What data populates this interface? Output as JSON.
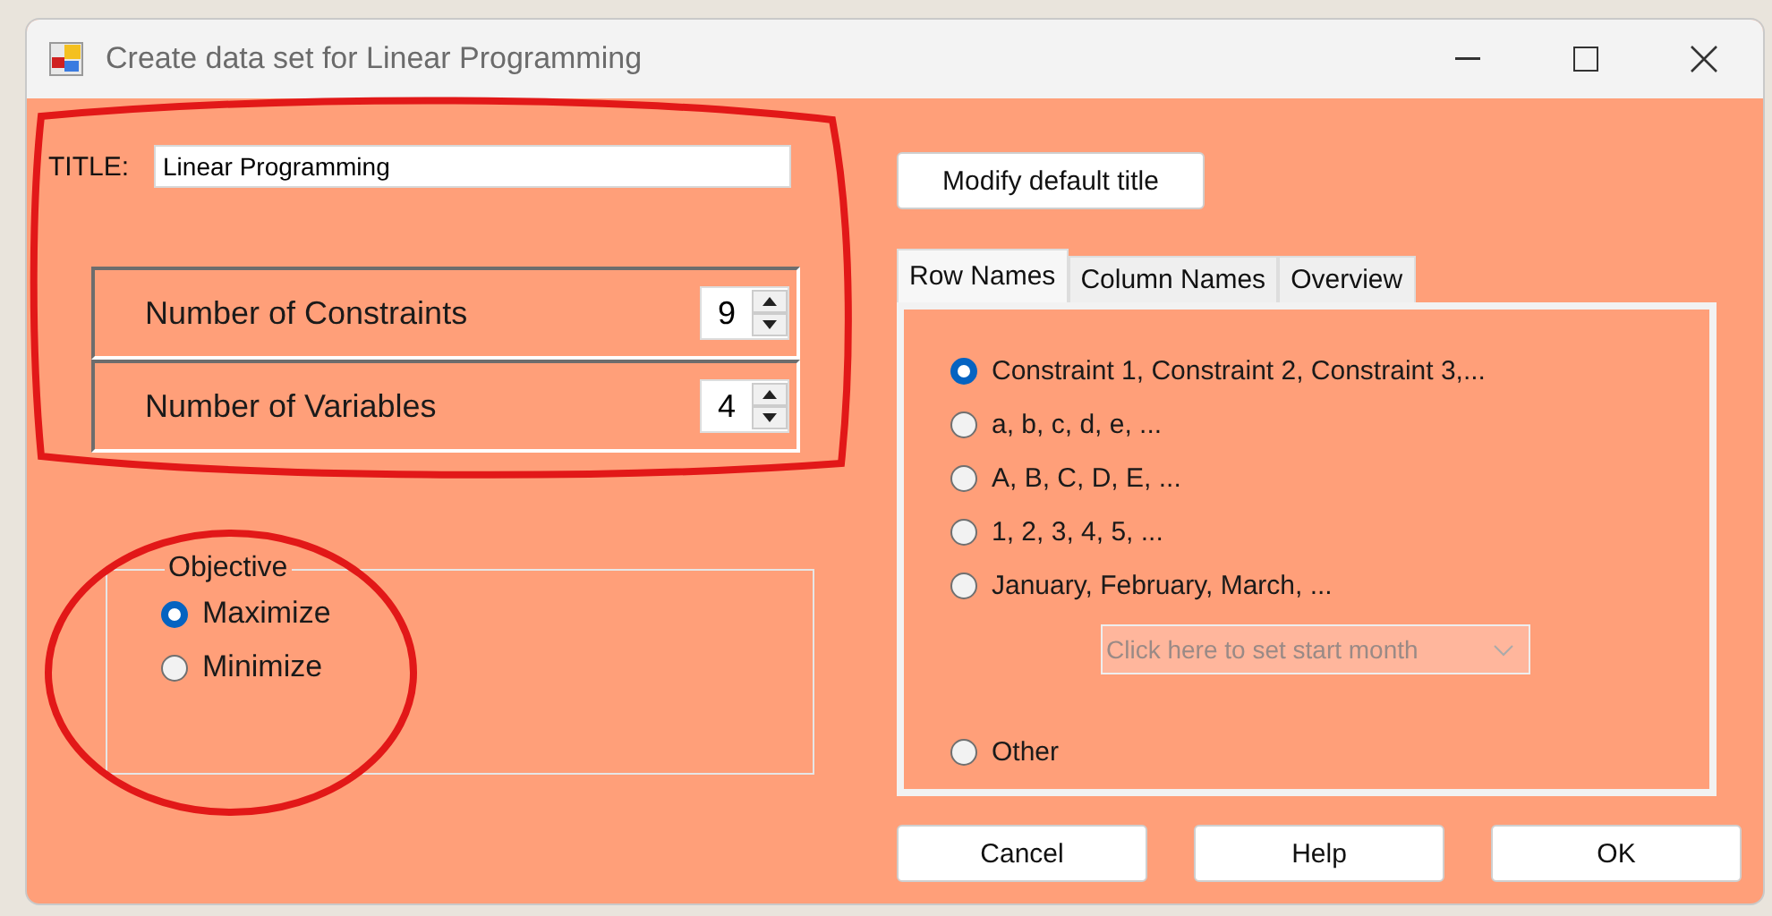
{
  "window": {
    "title": "Create data set for Linear Programming"
  },
  "title_field": {
    "label": "TITLE:",
    "value": "Linear Programming"
  },
  "counts": [
    {
      "label": "Number of Constraints",
      "value": "9"
    },
    {
      "label": "Number of Variables",
      "value": "4"
    }
  ],
  "objective": {
    "label": "Objective",
    "options": [
      {
        "label": "Maximize",
        "selected": true
      },
      {
        "label": "Minimize",
        "selected": false
      }
    ]
  },
  "modify_button": "Modify default title",
  "tabs": [
    {
      "label": "Row Names",
      "selected": true
    },
    {
      "label": "Column Names",
      "selected": false
    },
    {
      "label": "Overview",
      "selected": false
    }
  ],
  "row_names": [
    {
      "label": "Constraint 1, Constraint 2, Constraint 3,...",
      "selected": true
    },
    {
      "label": "a, b, c, d, e, ...",
      "selected": false
    },
    {
      "label": "A, B, C, D, E, ...",
      "selected": false
    },
    {
      "label": "1, 2, 3, 4, 5, ...",
      "selected": false
    },
    {
      "label": "January, February, March, ...",
      "selected": false,
      "start_month": {
        "placeholder": "Click here to set start month",
        "disabled": true
      }
    },
    {
      "label": "Other",
      "selected": false
    }
  ],
  "buttons": [
    "Cancel",
    "Help",
    "OK"
  ]
}
